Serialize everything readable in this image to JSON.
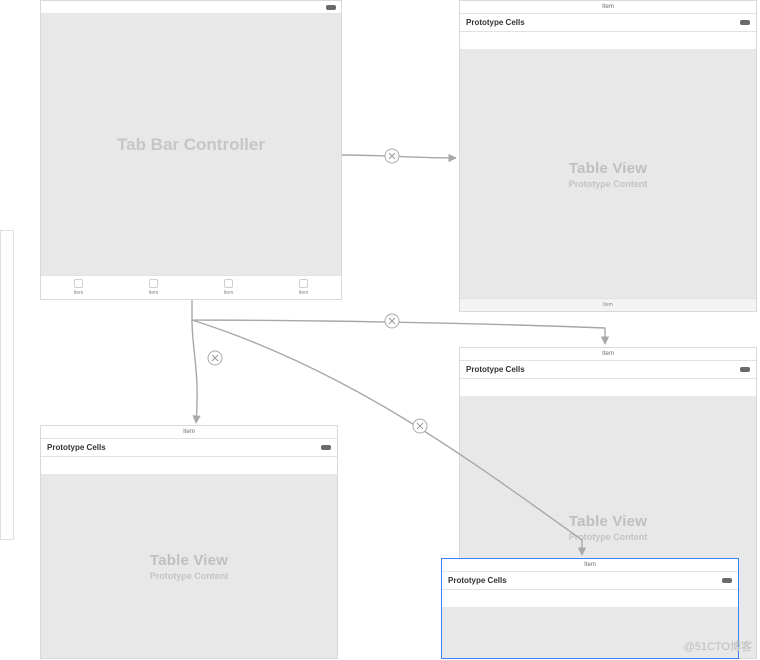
{
  "watermark": "@51CTO博客",
  "colors": {
    "sceneBodyBg": "#e8e8e8",
    "placeholderText": "#c0c0c0",
    "connector": "#a8a8a8"
  },
  "tabBarController": {
    "title": "Tab Bar Controller",
    "tabs": [
      "Item",
      "Item",
      "Item",
      "Item"
    ]
  },
  "tableView1": {
    "navTitle": "Item",
    "protoHeader": "Prototype Cells",
    "bodyTitle": "Table View",
    "bodySubtitle": "Prototype Content",
    "footer": "Item"
  },
  "tableView2": {
    "navTitle": "Item",
    "protoHeader": "Prototype Cells",
    "bodyTitle": "Table View",
    "bodySubtitle": "Prototype Content"
  },
  "tableView3": {
    "navTitle": "Item",
    "protoHeader": "Prototype Cells",
    "bodyTitle": "Table View",
    "bodySubtitle": "Prototype Content"
  },
  "tableView4": {
    "navTitle": "Item",
    "protoHeader": "Prototype Cells"
  },
  "connections": [
    {
      "from": "tabBarController",
      "to": "tableView1",
      "type": "relationship"
    },
    {
      "from": "tabBarController",
      "to": "tableView2",
      "type": "relationship"
    },
    {
      "from": "tabBarController",
      "to": "tableView3",
      "type": "relationship"
    },
    {
      "from": "tableView3",
      "to": "tableView4",
      "type": "push"
    }
  ]
}
